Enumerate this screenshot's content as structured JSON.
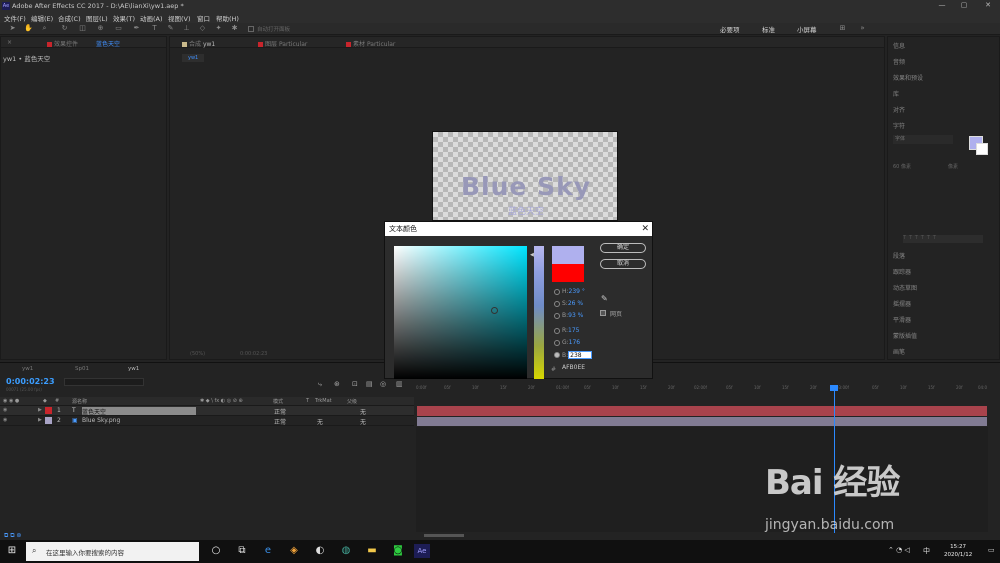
{
  "titlebar": {
    "title": "Adobe After Effects CC 2017 - D:\\AE\\lianXi\\yw1.aep *",
    "min": "—",
    "max": "▢",
    "close": "✕"
  },
  "menu": [
    "文件(F)",
    "编辑(E)",
    "合成(C)",
    "图层(L)",
    "效果(T)",
    "动画(A)",
    "视图(V)",
    "窗口",
    "帮助(H)"
  ],
  "toolbar": {
    "snap": "自动打开面板",
    "workspaces": [
      "必要项",
      "标准",
      "小屏幕"
    ]
  },
  "project": {
    "tab1": "效果控件",
    "tab2": "蓝色天空",
    "crumb": "yw1 • 蓝色天空"
  },
  "comp": {
    "tab1": "合成",
    "tab1b": "yw1",
    "tab2": "图层",
    "tab2b": "Particular",
    "tab3": "素材",
    "tab3b": "Particular",
    "subtab": "yw1",
    "zoom": "(50%)",
    "timecode": "0:00:02:23"
  },
  "canvas": {
    "text": "Blue Sky",
    "sub": "蓝色天空"
  },
  "right": {
    "items": [
      "信息",
      "音频",
      "效果和预设",
      "库",
      "对齐",
      "字符",
      "段落",
      "跟踪器",
      "动态草图",
      "摇摆器",
      "平滑器",
      "蒙版插值",
      "画笔"
    ],
    "font": "字体",
    "size": "60 像素",
    "px": "像素"
  },
  "dialog": {
    "title": "文本颜色",
    "ok": "确定",
    "cancel": "取消",
    "h_label": "H:",
    "h_val": "239 °",
    "s_label": "S:",
    "s_val": "26 %",
    "b_label": "B:",
    "b_val": "93 %",
    "r_label": "R:",
    "r_val": "175",
    "g_label": "G:",
    "g_val": "176",
    "b2_label": "B:",
    "b2_val": "238",
    "hex": "AFB0EE",
    "hexsym": "#",
    "check": "网页",
    "close": "✕"
  },
  "timeline": {
    "tabs": [
      "yw1",
      "Sp01",
      "yw1"
    ],
    "timecode": "0:00:02:23",
    "fps": "00071 (25.00 fps)",
    "headers": [
      "#",
      "源名称",
      "模式",
      "T",
      "TrkMat",
      "父级"
    ],
    "layers": [
      {
        "num": "1",
        "name": "蓝色天空",
        "mode": "正常",
        "trk": "",
        "parent": "无"
      },
      {
        "num": "2",
        "name": "Blue Sky.png",
        "mode": "正常",
        "trk": "无",
        "parent": "无"
      }
    ],
    "ruler": [
      "0:00f",
      "05f",
      "10f",
      "15f",
      "20f",
      "01:00f",
      "05f",
      "10f",
      "15f",
      "20f",
      "02:00f",
      "05f",
      "10f",
      "15f",
      "20f",
      "03:00f",
      "05f",
      "10f",
      "15f",
      "20f",
      "04:0"
    ]
  },
  "taskbar": {
    "search": "在这里输入你要搜索的内容",
    "time": "15:27",
    "date": "2020/1/12",
    "ime": "中"
  },
  "watermark": {
    "brand": "Bai 经验",
    "url": "jingyan.baidu.com"
  }
}
